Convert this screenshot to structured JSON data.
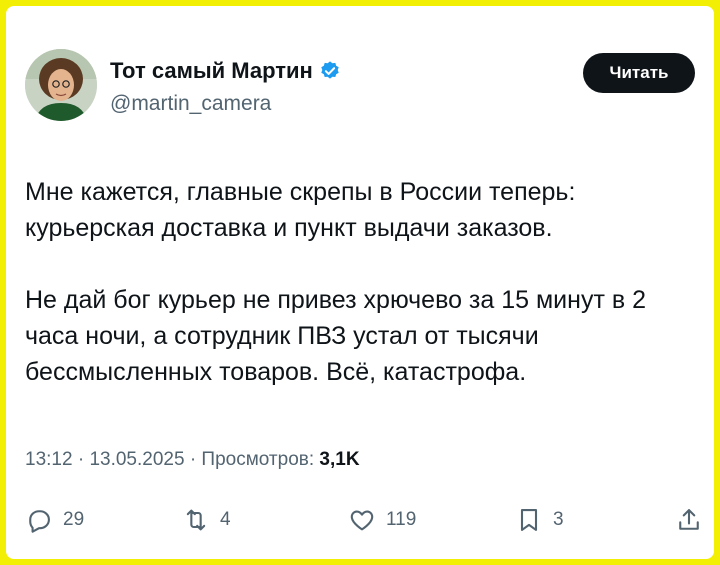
{
  "author": {
    "name": "Тот самый Мартин",
    "handle": "@martin_camera",
    "follow_label": "Читать"
  },
  "tweet": {
    "paragraph_1": "Мне кажется, главные скрепы в России теперь: курьерская доставка и пункт выдачи заказов.",
    "paragraph_2": "Не дай бог курьер не привез хрючево за 15 минут в 2 часа ночи, а сотрудник ПВЗ устал от тысячи бессмысленных товаров. Всё, катастрофа."
  },
  "meta": {
    "time": "13:12",
    "date": "13.05.2025",
    "views_label": "Просмотров:",
    "views_count": "3,1K"
  },
  "actions": {
    "replies": "29",
    "retweets": "4",
    "likes": "119",
    "bookmarks": "3"
  },
  "colors": {
    "frame": "#f2ef05",
    "verified": "#1d9bf0",
    "text": "#0f1419",
    "secondary": "#536471"
  }
}
